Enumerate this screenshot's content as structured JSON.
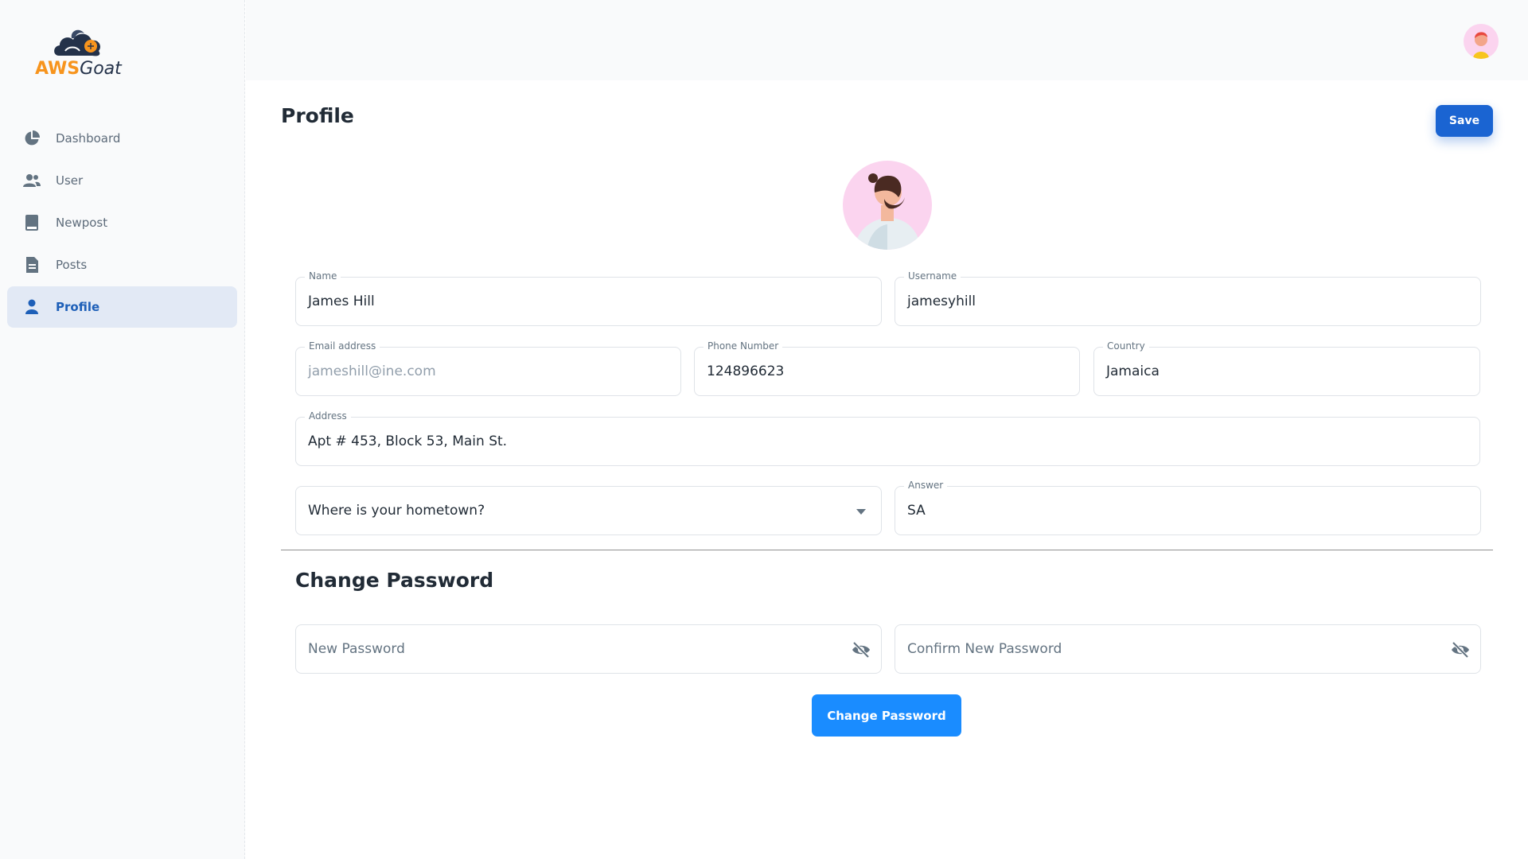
{
  "brand": {
    "aws": "AWS",
    "goat": "Goat"
  },
  "sidebar": {
    "items": [
      {
        "label": "Dashboard",
        "icon": "pie-chart-icon"
      },
      {
        "label": "User",
        "icon": "users-icon"
      },
      {
        "label": "Newpost",
        "icon": "book-icon"
      },
      {
        "label": "Posts",
        "icon": "document-icon"
      },
      {
        "label": "Profile",
        "icon": "person-icon",
        "active": true
      }
    ]
  },
  "page": {
    "title": "Profile",
    "save_label": "Save"
  },
  "form": {
    "name": {
      "label": "Name",
      "value": "James Hill"
    },
    "username": {
      "label": "Username",
      "value": "jamesyhill"
    },
    "email": {
      "label": "Email address",
      "value": "jameshill@ine.com"
    },
    "phone": {
      "label": "Phone Number",
      "value": "124896623"
    },
    "country": {
      "label": "Country",
      "value": "Jamaica"
    },
    "address": {
      "label": "Address",
      "value": "Apt # 453, Block 53, Main St."
    },
    "security_question": {
      "value": "Where is your hometown?"
    },
    "answer": {
      "label": "Answer",
      "value": "SA"
    }
  },
  "password": {
    "title": "Change Password",
    "new_placeholder": "New Password",
    "confirm_placeholder": "Confirm New Password",
    "button_label": "Change Password"
  },
  "colors": {
    "primary": "#1a64d2",
    "change_button": "#1a8cff",
    "active_nav_bg": "#e2e9f5",
    "avatar_bg": "#fbd4ef",
    "brand_orange": "#f7941d"
  }
}
